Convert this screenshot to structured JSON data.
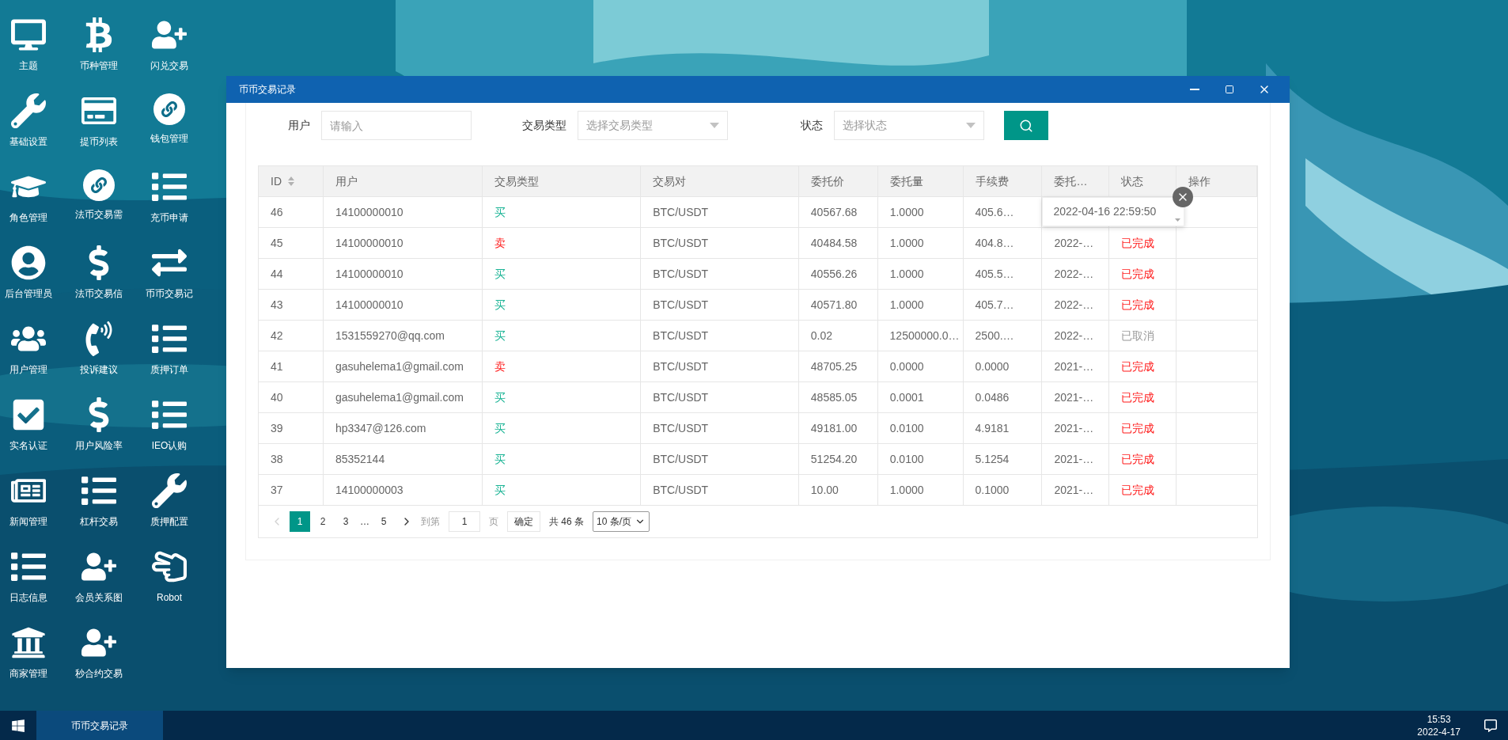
{
  "desktop_icons": [
    {
      "label": "主题"
    },
    {
      "label": "币种管理"
    },
    {
      "label": "闪兑交易"
    },
    {
      "label": "基础设置"
    },
    {
      "label": "提币列表"
    },
    {
      "label": "钱包管理"
    },
    {
      "label": "角色管理"
    },
    {
      "label": "法币交易需"
    },
    {
      "label": "充币申请"
    },
    {
      "label": "后台管理员"
    },
    {
      "label": "法币交易信"
    },
    {
      "label": "币币交易记"
    },
    {
      "label": "用户管理"
    },
    {
      "label": "投诉建议"
    },
    {
      "label": "质押订单"
    },
    {
      "label": "实名认证"
    },
    {
      "label": "用户风险率"
    },
    {
      "label": "IEO认购"
    },
    {
      "label": "新闻管理"
    },
    {
      "label": "杠杆交易"
    },
    {
      "label": "质押配置"
    },
    {
      "label": "日志信息"
    },
    {
      "label": "会员关系图"
    },
    {
      "label": "Robot"
    },
    {
      "label": "商家管理"
    },
    {
      "label": "秒合约交易"
    }
  ],
  "window": {
    "title": "币币交易记录"
  },
  "filters": [
    {
      "label": "用户",
      "kind": "input",
      "placeholder": "请输入"
    },
    {
      "label": "交易类型",
      "kind": "select",
      "placeholder": "选择交易类型"
    },
    {
      "label": "状态",
      "kind": "select",
      "placeholder": "选择状态"
    }
  ],
  "table": {
    "columns": [
      {
        "label": "ID",
        "sortable": true
      },
      {
        "label": "用户",
        "sortable": false
      },
      {
        "label": "交易类型",
        "sortable": false
      },
      {
        "label": "交易对",
        "sortable": false
      },
      {
        "label": "委托价",
        "sortable": false
      },
      {
        "label": "委托量",
        "sortable": false
      },
      {
        "label": "手续费",
        "sortable": false
      },
      {
        "label": "委托…",
        "sortable": false
      },
      {
        "label": "状态",
        "sortable": false
      },
      {
        "label": "操作",
        "sortable": false
      }
    ],
    "rows": [
      {
        "id": "46",
        "user": "14100000010",
        "type": {
          "text": "买",
          "kind": "buy"
        },
        "pair": "BTC/USDT",
        "price": "40567.68",
        "amount": "1.0000",
        "fee": "405.6…",
        "tooltip": "2022-04-16 22:59:50"
      },
      {
        "id": "45",
        "user": "14100000010",
        "type": {
          "text": "卖",
          "kind": "sell"
        },
        "pair": "BTC/USDT",
        "price": "40484.58",
        "amount": "1.0000",
        "fee": "404.8…",
        "time": "2022-…",
        "status": {
          "text": "已完成",
          "kind": "done"
        }
      },
      {
        "id": "44",
        "user": "14100000010",
        "type": {
          "text": "买",
          "kind": "buy"
        },
        "pair": "BTC/USDT",
        "price": "40556.26",
        "amount": "1.0000",
        "fee": "405.5…",
        "time": "2022-…",
        "status": {
          "text": "已完成",
          "kind": "done"
        }
      },
      {
        "id": "43",
        "user": "14100000010",
        "type": {
          "text": "买",
          "kind": "buy"
        },
        "pair": "BTC/USDT",
        "price": "40571.80",
        "amount": "1.0000",
        "fee": "405.7…",
        "time": "2022-…",
        "status": {
          "text": "已完成",
          "kind": "done"
        }
      },
      {
        "id": "42",
        "user": "1531559270@qq.com",
        "type": {
          "text": "买",
          "kind": "buy"
        },
        "pair": "BTC/USDT",
        "price": "0.02",
        "amount": "12500000.0…",
        "fee": "2500.…",
        "time": "2022-…",
        "status": {
          "text": "已取消",
          "kind": "cancelled"
        }
      },
      {
        "id": "41",
        "user": "gasuhelema1@gmail.com",
        "type": {
          "text": "卖",
          "kind": "sell"
        },
        "pair": "BTC/USDT",
        "price": "48705.25",
        "amount": "0.0000",
        "fee": "0.0000",
        "time": "2021-…",
        "status": {
          "text": "已完成",
          "kind": "done"
        }
      },
      {
        "id": "40",
        "user": "gasuhelema1@gmail.com",
        "type": {
          "text": "买",
          "kind": "buy"
        },
        "pair": "BTC/USDT",
        "price": "48585.05",
        "amount": "0.0001",
        "fee": "0.0486",
        "time": "2021-…",
        "status": {
          "text": "已完成",
          "kind": "done"
        }
      },
      {
        "id": "39",
        "user": "hp3347@126.com",
        "type": {
          "text": "买",
          "kind": "buy"
        },
        "pair": "BTC/USDT",
        "price": "49181.00",
        "amount": "0.0100",
        "fee": "4.9181",
        "time": "2021-…",
        "status": {
          "text": "已完成",
          "kind": "done"
        }
      },
      {
        "id": "38",
        "user": "85352144",
        "type": {
          "text": "买",
          "kind": "buy"
        },
        "pair": "BTC/USDT",
        "price": "51254.20",
        "amount": "0.0100",
        "fee": "5.1254",
        "time": "2021-…",
        "status": {
          "text": "已完成",
          "kind": "done"
        }
      },
      {
        "id": "37",
        "user": "14100000003",
        "type": {
          "text": "买",
          "kind": "buy"
        },
        "pair": "BTC/USDT",
        "price": "10.00",
        "amount": "1.0000",
        "fee": "0.1000",
        "time": "2021-…",
        "status": {
          "text": "已完成",
          "kind": "done"
        }
      }
    ]
  },
  "pagination": {
    "prev_disabled": true,
    "pages": [
      {
        "label": "1",
        "selected": true
      },
      {
        "label": "2",
        "selected": false
      },
      {
        "label": "3",
        "selected": false
      },
      {
        "label": "5",
        "selected": false
      }
    ],
    "ellipsis": "…",
    "goto_label": "到第",
    "goto_value": "1",
    "page_unit": "页",
    "confirm": "确定",
    "total": "共 46 条",
    "page_size": "10 条/页"
  },
  "taskbar": {
    "tasks": [
      {
        "label": "币币交易记录",
        "selected": true
      }
    ],
    "time": "15:53",
    "date": "2022-4-17"
  }
}
